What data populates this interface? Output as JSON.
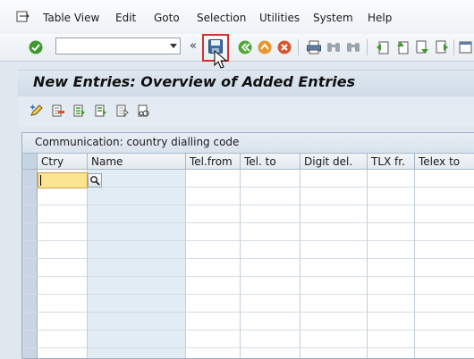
{
  "menu": {
    "items": [
      {
        "label": "Table View"
      },
      {
        "label": "Edit"
      },
      {
        "label": "Goto"
      },
      {
        "label": "Selection"
      },
      {
        "label": "Utilities"
      },
      {
        "label": "System"
      },
      {
        "label": "Help"
      }
    ]
  },
  "toolbar": {
    "command_value": "",
    "chevron": "«"
  },
  "screen": {
    "title": "New Entries: Overview of Added Entries"
  },
  "table": {
    "caption": "Communication: country dialling code",
    "columns": [
      {
        "label": "Ctry"
      },
      {
        "label": "Name"
      },
      {
        "label": "Tel.from"
      },
      {
        "label": "Tel. to"
      },
      {
        "label": "Digit del."
      },
      {
        "label": "TLX fr."
      },
      {
        "label": "Telex to"
      }
    ],
    "ctry_value": ""
  },
  "colors": {
    "active_field": "#fbe58f",
    "highlight": "#d83030",
    "title_bg": "#cfdbe7",
    "ok_green": "#3e9a2e",
    "nav_orange": "#e7952c",
    "cancel_red": "#d9542a"
  },
  "icons": {
    "menu": "enter-menu-icon",
    "enter": "enter-check-icon",
    "save": "save-icon",
    "back": "back-icon",
    "exit": "exit-icon",
    "cancel": "cancel-icon",
    "print": "print-icon",
    "find": "find-icon",
    "find_next": "find-next-icon",
    "first_page": "first-page-icon",
    "prev_page": "previous-page-icon",
    "next_page": "next-page-icon",
    "last_page": "last-page-icon",
    "new_session": "new-session-icon",
    "change_display": "change-display-icon",
    "delete": "delete-icon",
    "select_all": "select-all-icon",
    "select_block": "select-block-icon",
    "deselect_all": "deselect-all-icon",
    "tx_info": "transport-info-icon",
    "f4_help": "value-help-icon",
    "cursor": "mouse-pointer-icon"
  }
}
